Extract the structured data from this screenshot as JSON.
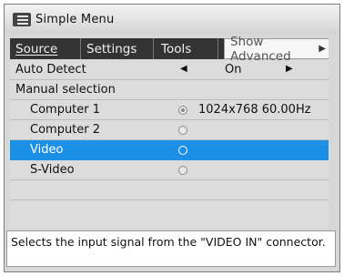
{
  "window": {
    "title": "Simple Menu",
    "icon": "menu-list-icon"
  },
  "tabs": [
    {
      "label": "Source",
      "active": true
    },
    {
      "label": "Settings",
      "active": false
    },
    {
      "label": "Tools",
      "active": false
    }
  ],
  "advanced": {
    "label": "Show Advanced",
    "icon": "triangle-right-icon"
  },
  "auto_detect": {
    "label": "Auto Detect",
    "value": "On",
    "left_icon": "triangle-left-icon",
    "right_icon": "triangle-right-icon"
  },
  "manual": {
    "label": "Manual selection"
  },
  "sources": [
    {
      "label": "Computer 1",
      "checked": true,
      "info": "1024x768 60.00Hz"
    },
    {
      "label": "Computer 2",
      "checked": false,
      "info": ""
    },
    {
      "label": "Video",
      "checked": false,
      "info": "",
      "highlighted": true
    },
    {
      "label": "S-Video",
      "checked": false,
      "info": ""
    }
  ],
  "status_text": "Selects the input signal from the \"VIDEO IN\" connector.",
  "colors": {
    "highlight": "#1c8fe6",
    "tab_bar": "#333333",
    "panel": "#dcdcdc"
  }
}
